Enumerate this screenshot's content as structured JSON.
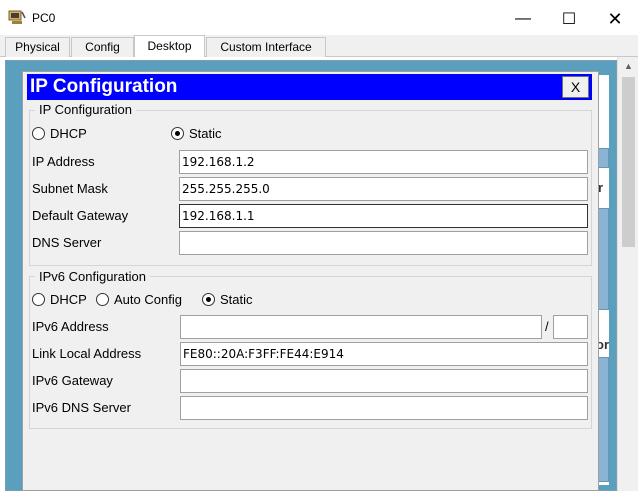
{
  "window": {
    "title": "PC0",
    "minimize": "—",
    "maximize": "☐",
    "close": "✕"
  },
  "tabs": [
    {
      "label": "Physical"
    },
    {
      "label": "Config"
    },
    {
      "label": "Desktop"
    },
    {
      "label": "Custom Interface"
    }
  ],
  "active_tab": "Desktop",
  "background": {
    "partial_text": "r",
    "partial_text2": "or"
  },
  "dialog": {
    "title": "IP Configuration",
    "close_label": "X",
    "ipv4": {
      "legend": "IP Configuration",
      "dhcp_label": "DHCP",
      "static_label": "Static",
      "selected": "Static",
      "ip_address_label": "IP Address",
      "ip_address_value": "192.168.1.2",
      "subnet_mask_label": "Subnet Mask",
      "subnet_mask_value": "255.255.255.0",
      "gateway_label": "Default Gateway",
      "gateway_value": "192.168.1.1",
      "dns_label": "DNS Server",
      "dns_value": ""
    },
    "ipv6": {
      "legend": "IPv6 Configuration",
      "dhcp_label": "DHCP",
      "auto_label": "Auto Config",
      "static_label": "Static",
      "selected": "Static",
      "address_label": "IPv6 Address",
      "address_value": "",
      "prefix_separator": "/",
      "prefix_value": "",
      "link_local_label": "Link Local Address",
      "link_local_value": "FE80::20A:F3FF:FE44:E914",
      "gateway_label": "IPv6 Gateway",
      "gateway_value": "",
      "dns_label": "IPv6 DNS Server",
      "dns_value": ""
    }
  },
  "colors": {
    "title_bar": "#0000ff",
    "desktop_bg": "#5a9fbd"
  }
}
